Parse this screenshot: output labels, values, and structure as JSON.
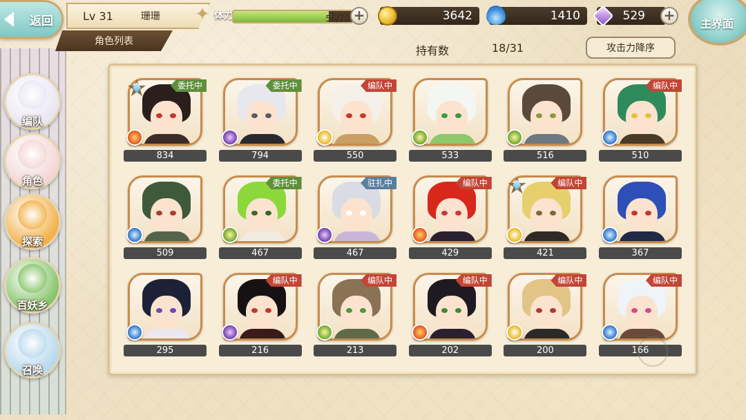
{
  "header": {
    "back_label": "返回",
    "level": "Lv 31",
    "player_name": "珊珊",
    "page_title": "角色列表",
    "main_label": "主界面"
  },
  "stamina": {
    "label": "体力",
    "value_text": "56/70",
    "current": 56,
    "max": 70
  },
  "currencies": [
    {
      "name": "gold",
      "icon": "coin-icon",
      "value": "3642"
    },
    {
      "name": "spirit",
      "icon": "blue-flame-icon",
      "value": "1410"
    },
    {
      "name": "crystal",
      "icon": "gem-icon",
      "value": "529"
    }
  ],
  "owned": {
    "label": "持有数",
    "value": "18/31"
  },
  "sort": {
    "label": "攻击力降序"
  },
  "sidebar": {
    "items": [
      {
        "label": "编队",
        "color": "#e9e6f3"
      },
      {
        "label": "角色",
        "color": "#f3d6d6"
      },
      {
        "label": "探索",
        "color": "#f2b14a"
      },
      {
        "label": "百妖乡",
        "color": "#86c46a"
      },
      {
        "label": "召唤",
        "color": "#b9d9ee"
      }
    ]
  },
  "status_labels": {
    "delegate": "委托中",
    "team": "编队中",
    "station": "驻扎中"
  },
  "characters": [
    {
      "power": "834",
      "status": "委托中",
      "element": "fire",
      "starred": true,
      "hair": "#2a1f1c",
      "eye": "#c0392b",
      "outfit": "#3b2c26"
    },
    {
      "power": "794",
      "status": "委托中",
      "element": "dark",
      "starred": false,
      "hair": "#e6e8ee",
      "eye": "#5a5a66",
      "outfit": "#2a2a2e"
    },
    {
      "power": "550",
      "status": "编队中",
      "element": "light",
      "starred": false,
      "hair": "#f5f1ea",
      "eye": "#c43b2b",
      "outfit": "#c9a063"
    },
    {
      "power": "533",
      "status": "",
      "element": "wind",
      "starred": false,
      "hair": "#f4f6f2",
      "eye": "#3c9a3c",
      "outfit": "#8fc86a"
    },
    {
      "power": "516",
      "status": "",
      "element": "wind",
      "starred": false,
      "hair": "#5b4a3c",
      "eye": "#8a9a3c",
      "outfit": "#6e7880"
    },
    {
      "power": "510",
      "status": "编队中",
      "element": "water",
      "starred": false,
      "hair": "#2f8a5c",
      "eye": "#e2c23a",
      "outfit": "#4a3a28"
    },
    {
      "power": "509",
      "status": "",
      "element": "water",
      "starred": false,
      "hair": "#3e5a3a",
      "eye": "#a04030",
      "outfit": "#54644a"
    },
    {
      "power": "467",
      "status": "委托中",
      "element": "wind",
      "starred": false,
      "hair": "#8cd83a",
      "eye": "#3a6a20",
      "outfit": "#f1ece0"
    },
    {
      "power": "467",
      "status": "驻扎中",
      "element": "dark",
      "starred": false,
      "hair": "#d9dce4",
      "eye": "#ffffff",
      "outfit": "#c8b6d8"
    },
    {
      "power": "429",
      "status": "编队中",
      "element": "fire",
      "starred": false,
      "hair": "#d8281c",
      "eye": "#c23b3b",
      "outfit": "#2a2030"
    },
    {
      "power": "421",
      "status": "编队中",
      "element": "light",
      "starred": true,
      "hair": "#e8cf6e",
      "eye": "#7a6a3a",
      "outfit": "#2f2a28"
    },
    {
      "power": "367",
      "status": "",
      "element": "water",
      "starred": false,
      "hair": "#2f4fb8",
      "eye": "#c0392b",
      "outfit": "#1f2a44"
    },
    {
      "power": "295",
      "status": "",
      "element": "water",
      "starred": false,
      "hair": "#1d2138",
      "eye": "#6a4ab4",
      "outfit": "#ebe8f2"
    },
    {
      "power": "216",
      "status": "编队中",
      "element": "dark",
      "starred": false,
      "hair": "#161214",
      "eye": "#c0392b",
      "outfit": "#3a1a1a"
    },
    {
      "power": "213",
      "status": "编队中",
      "element": "wind",
      "starred": false,
      "hair": "#8a7354",
      "eye": "#4a9a3a",
      "outfit": "#5e6a4a"
    },
    {
      "power": "202",
      "status": "编队中",
      "element": "fire",
      "starred": false,
      "hair": "#1e1a22",
      "eye": "#3a8a3a",
      "outfit": "#2a2030"
    },
    {
      "power": "200",
      "status": "编队中",
      "element": "light",
      "starred": false,
      "hair": "#e2c486",
      "eye": "#b03a2a",
      "outfit": "#2c2a28"
    },
    {
      "power": "166",
      "status": "编队中",
      "element": "water",
      "starred": false,
      "hair": "#eef4f8",
      "eye": "#d44a8a",
      "outfit": "#6a4a3a"
    }
  ]
}
